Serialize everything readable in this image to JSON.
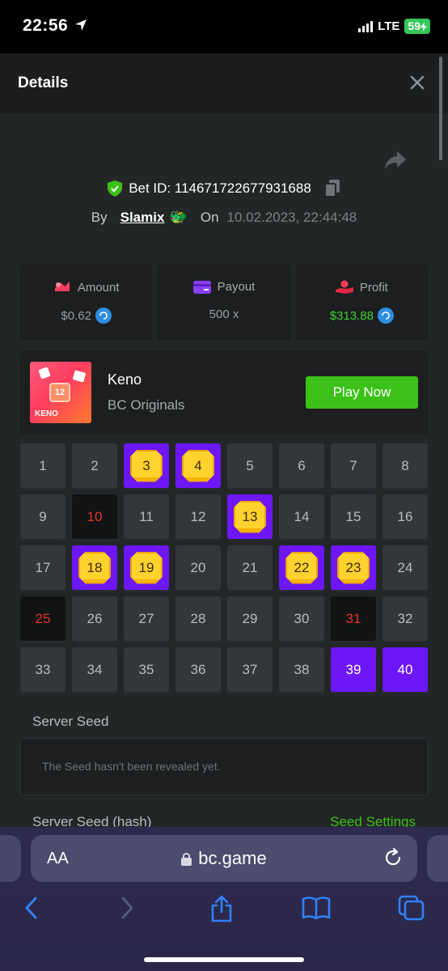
{
  "status_bar": {
    "time": "22:56",
    "network": "LTE",
    "battery": "59"
  },
  "header": {
    "title": "Details"
  },
  "bet": {
    "id_label": "Bet ID: 114671722677931688",
    "by_label": "By",
    "username": "Slamix",
    "user_emoji": "🐲",
    "on_label": "On",
    "date": "10.02.2023, 22:44:48"
  },
  "stats": [
    {
      "label": "Amount",
      "value": "$0.62",
      "icon": "bet-amount-icon"
    },
    {
      "label": "Payout",
      "value": "500 x",
      "icon": "wallet-card-icon"
    },
    {
      "label": "Profit",
      "value": "$313.88",
      "icon": "hand-coin-icon"
    }
  ],
  "game": {
    "thumb_number": "12",
    "thumb_text": "KENO",
    "name": "Keno",
    "provider": "BC Originals",
    "play_label": "Play Now"
  },
  "keno_grid": [
    {
      "n": "1",
      "s": "normal"
    },
    {
      "n": "2",
      "s": "normal"
    },
    {
      "n": "3",
      "s": "hit"
    },
    {
      "n": "4",
      "s": "hit"
    },
    {
      "n": "5",
      "s": "normal"
    },
    {
      "n": "6",
      "s": "normal"
    },
    {
      "n": "7",
      "s": "normal"
    },
    {
      "n": "8",
      "s": "normal"
    },
    {
      "n": "9",
      "s": "normal"
    },
    {
      "n": "10",
      "s": "miss"
    },
    {
      "n": "11",
      "s": "normal"
    },
    {
      "n": "12",
      "s": "normal"
    },
    {
      "n": "13",
      "s": "hit"
    },
    {
      "n": "14",
      "s": "normal"
    },
    {
      "n": "15",
      "s": "normal"
    },
    {
      "n": "16",
      "s": "normal"
    },
    {
      "n": "17",
      "s": "normal"
    },
    {
      "n": "18",
      "s": "hit"
    },
    {
      "n": "19",
      "s": "hit"
    },
    {
      "n": "20",
      "s": "normal"
    },
    {
      "n": "21",
      "s": "normal"
    },
    {
      "n": "22",
      "s": "hit"
    },
    {
      "n": "23",
      "s": "hit"
    },
    {
      "n": "24",
      "s": "normal"
    },
    {
      "n": "25",
      "s": "miss"
    },
    {
      "n": "26",
      "s": "normal"
    },
    {
      "n": "27",
      "s": "normal"
    },
    {
      "n": "28",
      "s": "normal"
    },
    {
      "n": "29",
      "s": "normal"
    },
    {
      "n": "30",
      "s": "normal"
    },
    {
      "n": "31",
      "s": "miss"
    },
    {
      "n": "32",
      "s": "normal"
    },
    {
      "n": "33",
      "s": "normal"
    },
    {
      "n": "34",
      "s": "normal"
    },
    {
      "n": "35",
      "s": "normal"
    },
    {
      "n": "36",
      "s": "normal"
    },
    {
      "n": "37",
      "s": "normal"
    },
    {
      "n": "38",
      "s": "normal"
    },
    {
      "n": "39",
      "s": "pick"
    },
    {
      "n": "40",
      "s": "pick"
    }
  ],
  "seed": {
    "server_seed_label": "Server Seed",
    "server_seed_message": "The Seed hasn't been revealed yet.",
    "hash_label": "Server Seed (hash)",
    "settings_label": "Seed Settings"
  },
  "browser": {
    "aa_label": "AA",
    "url": "bc.game"
  },
  "colors": {
    "accent_green": "#3bc117",
    "pick_purple": "#6d16f7",
    "gem_yellow": "#ffd22e",
    "miss_red": "#e3342f",
    "sheet_bg": "#232626"
  }
}
